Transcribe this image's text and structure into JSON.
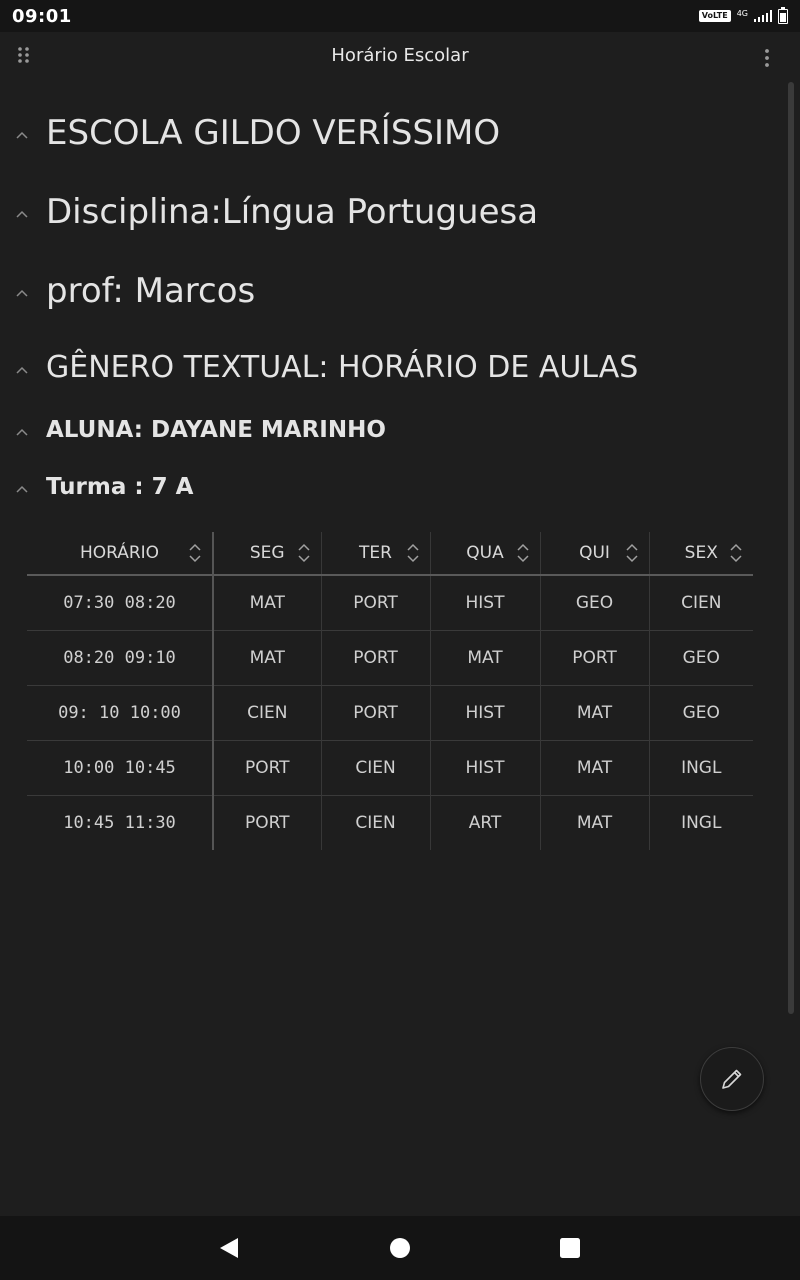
{
  "status_bar": {
    "time": "09:01",
    "volte_label": "VoLTE",
    "network_label": "4G"
  },
  "app_bar": {
    "title": "Horário Escolar",
    "left_icon": "drag-handle-icon",
    "right_icon": "more-vert-icon"
  },
  "headings": [
    {
      "text": "ESCOLA GILDO VERÍSSIMO",
      "level": 1
    },
    {
      "text": "Disciplina:Língua Portuguesa",
      "level": 1
    },
    {
      "text": "prof: Marcos",
      "level": 1
    },
    {
      "text": "GÊNERO TEXTUAL: HORÁRIO DE AULAS",
      "level": 2
    },
    {
      "text": "ALUNA: DAYANE MARINHO",
      "level": 3
    },
    {
      "text": "Turma : 7 A",
      "level": 3
    }
  ],
  "table": {
    "columns": [
      "HORÁRIO",
      "SEG",
      "TER",
      "QUA",
      "QUI",
      "SEX"
    ],
    "rows": [
      [
        "07:30 08:20",
        "MAT",
        "PORT",
        "HIST",
        "GEO",
        "CIEN"
      ],
      [
        "08:20 09:10",
        "MAT",
        "PORT",
        "MAT",
        "PORT",
        "GEO"
      ],
      [
        "09: 10 10:00",
        "CIEN",
        "PORT",
        "HIST",
        "MAT",
        "GEO"
      ],
      [
        "10:00 10:45",
        "PORT",
        "CIEN",
        "HIST",
        "MAT",
        "INGL"
      ],
      [
        "10:45 11:30",
        "PORT",
        "CIEN",
        "ART",
        "MAT",
        "INGL"
      ]
    ]
  },
  "fab": {
    "icon": "edit-pencil-icon"
  },
  "nav_bar": {
    "icons": [
      "back-icon",
      "home-icon",
      "recents-icon"
    ]
  },
  "colors": {
    "background": "#1e1e1e",
    "text": "#e4e4e4",
    "status_bar": "#151515",
    "nav_bar": "#141414"
  }
}
